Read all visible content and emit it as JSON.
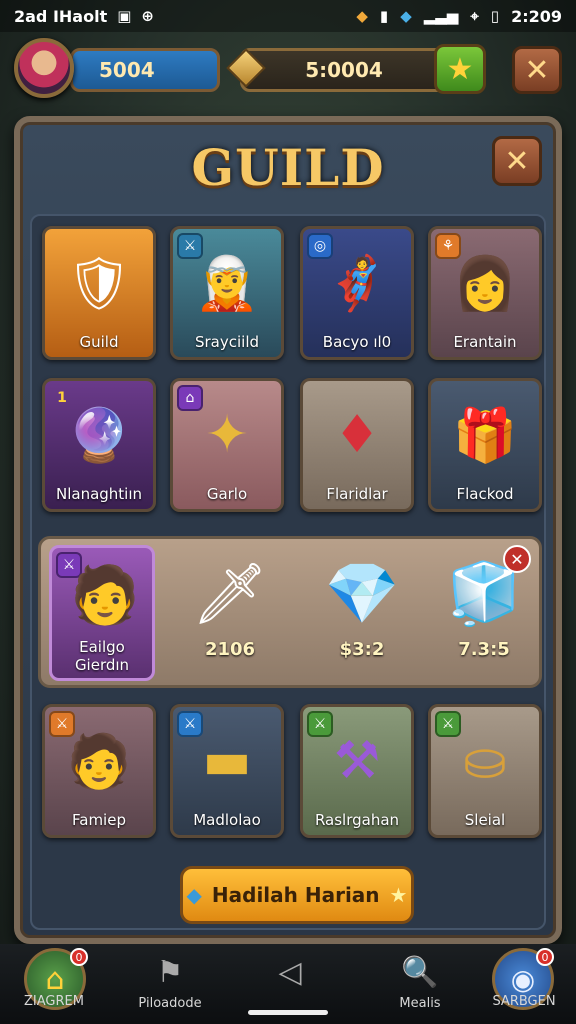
{
  "status": {
    "left_text": "2ad IHaolt",
    "time": "2:209",
    "icons": [
      "photo-icon",
      "wifi-icon",
      "signal-icon",
      "battery-icon"
    ]
  },
  "resources": {
    "primary_value": "5004",
    "secondary_value": "5:0004",
    "colors": {
      "primary": "#2e7bc2",
      "secondary": "#3d3528",
      "star_btn": "#7bc73a"
    }
  },
  "panel": {
    "title": "GUILD"
  },
  "grid_row1": [
    {
      "label": "Guild",
      "art": "🛡",
      "badge": ""
    },
    {
      "label": "Srayciild",
      "art": "🧝",
      "badge": "⚔"
    },
    {
      "label": "Bacyo ıl0",
      "art": "🦸",
      "badge": "◎"
    },
    {
      "label": "Erantain",
      "art": "👩",
      "badge": "⚘"
    }
  ],
  "grid_row2": [
    {
      "label": "Nlanaghtiın",
      "art": "🔮",
      "badge": "1"
    },
    {
      "label": "Garlo",
      "art": "✦",
      "badge": "⌂"
    },
    {
      "label": "Flaridlar",
      "art": "♦",
      "badge": ""
    },
    {
      "label": "Flackod",
      "art": "🎁",
      "badge": ""
    }
  ],
  "featured": {
    "hero_label": "Eailgo Gierdın",
    "items": [
      {
        "value": "2106",
        "icon": "🗡"
      },
      {
        "value": "$3:2",
        "icon": "💎"
      },
      {
        "value": "7.3:5",
        "icon": "🧊"
      }
    ]
  },
  "grid_row3": [
    {
      "label": "Famiep",
      "art": "🧑",
      "badge": "⚔"
    },
    {
      "label": "Madlolao",
      "art": "▬",
      "badge": "⚔"
    },
    {
      "label": "Raslrgahan",
      "art": "⚒",
      "badge": "⚔"
    },
    {
      "label": "Sleial",
      "art": "⛀",
      "badge": "⚔"
    }
  ],
  "daily_button": {
    "label": "Hadilah Harian"
  },
  "nav": {
    "home_label": "ZIAGREM",
    "item2_label": "Piloadode",
    "item4_label": "Mealis",
    "right_label": "SARBGEN"
  }
}
